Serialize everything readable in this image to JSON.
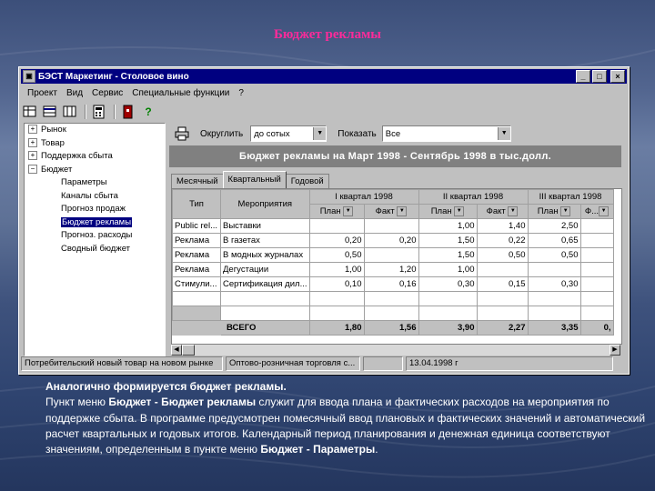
{
  "slide_title": "Бюджет рекламы",
  "window": {
    "title": "БЭСТ Маркетинг - Столовое вино",
    "min_label": "_",
    "max_label": "□",
    "close_label": "×"
  },
  "menu": [
    "Проект",
    "Вид",
    "Сервис",
    "Специальные функции",
    "?"
  ],
  "toolbar": {
    "icons": [
      "table-icon",
      "grid-icon",
      "columns-icon",
      "calculator-icon",
      "exit-icon",
      "help-icon"
    ]
  },
  "tree": {
    "items": [
      {
        "label": "Рынок",
        "expander": "+"
      },
      {
        "label": "Товар",
        "expander": "+"
      },
      {
        "label": "Поддержка сбыта",
        "expander": "+"
      },
      {
        "label": "Бюджет",
        "expander": "−"
      }
    ],
    "children": [
      "Параметры",
      "Каналы сбыта",
      "Прогноз продаж",
      "Бюджет рекламы",
      "Прогноз. расходы",
      "Сводный бюджет"
    ],
    "selected_child": "Бюджет рекламы"
  },
  "controls": {
    "round_label": "Округлить",
    "round_value": "до сотых",
    "show_label": "Показать",
    "show_value": "Все"
  },
  "heading": "Бюджет рекламы на Март 1998 - Сентябрь 1998 в тыс.долл.",
  "tabs": [
    {
      "label": "Месячный",
      "active": false
    },
    {
      "label": "Квартальный",
      "active": true
    },
    {
      "label": "Годовой",
      "active": false
    }
  ],
  "grid": {
    "col_type": "Тип",
    "col_events": "Мероприятия",
    "quarters": [
      "I квартал 1998",
      "II квартал 1998",
      "III квартал 1998"
    ],
    "sub": [
      "План",
      "Факт",
      "План",
      "Факт",
      "План",
      "Ф..."
    ],
    "rows": [
      {
        "type": "Public rel...",
        "event": "Выставки",
        "vals": [
          "",
          "",
          "1,00",
          "1,40",
          "2,50",
          ""
        ]
      },
      {
        "type": "Реклама",
        "event": "В газетах",
        "vals": [
          "0,20",
          "0,20",
          "1,50",
          "0,22",
          "0,65",
          ""
        ]
      },
      {
        "type": "Реклама",
        "event": "В модных журналах",
        "vals": [
          "0,50",
          "",
          "1,50",
          "0,50",
          "0,50",
          ""
        ]
      },
      {
        "type": "Реклама",
        "event": "Дегустации",
        "vals": [
          "1,00",
          "1,20",
          "1,00",
          "",
          "",
          ""
        ]
      },
      {
        "type": "Стимули...",
        "event": "Сертификация дил...",
        "vals": [
          "0,10",
          "0,16",
          "0,30",
          "0,15",
          "0,30",
          ""
        ]
      }
    ],
    "total_label": "ВСЕГО",
    "totals": [
      "1,80",
      "1,56",
      "3,90",
      "2,27",
      "3,35",
      "0,"
    ]
  },
  "status": [
    "Потребительский новый товар на новом рынке",
    "Оптово-розничная торговля с...",
    "",
    "13.04.1998 г"
  ],
  "body": {
    "lead": "Аналогично формируется бюджет рекламы.",
    "p1_a": "Пункт меню ",
    "p1_b": "Бюджет - Бюджет рекламы",
    "p1_c": " служит для ввода плана и фактических расходов на мероприятия по поддержке сбыта. В программе предусмотрен помесячный ввод плановых и фактических значений и автоматический расчет квартальных и годовых итогов. Календарный период планирования и денежная единица соответствуют значениям, определенным в пункте меню ",
    "p1_d": "Бюджет - Параметры",
    "p1_e": "."
  },
  "colors": {
    "title": "#ff2a9a",
    "titlebar": "#000080",
    "window": "#c0c0c0",
    "heading": "#808080"
  }
}
